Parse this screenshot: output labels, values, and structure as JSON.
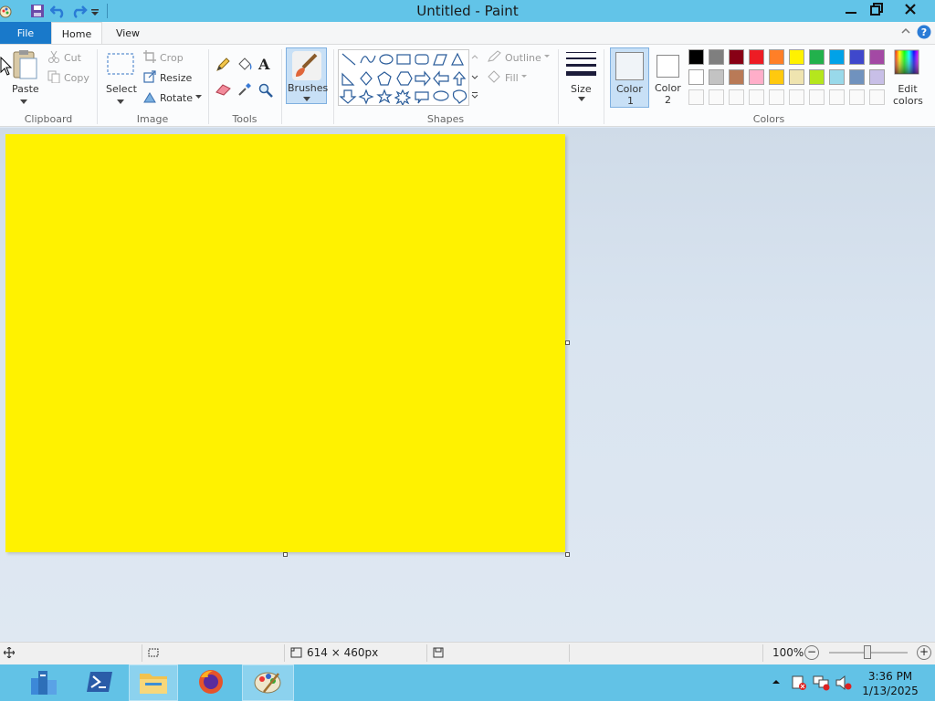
{
  "window": {
    "title": "Untitled - Paint",
    "minimize_glyph": "—",
    "close_glyph": "✕"
  },
  "ribbon": {
    "tabs": {
      "file": "File",
      "home": "Home",
      "view": "View"
    },
    "clipboard": {
      "paste": "Paste",
      "cut": "Cut",
      "copy": "Copy",
      "group": "Clipboard"
    },
    "image": {
      "select": "Select",
      "crop": "Crop",
      "resize": "Resize",
      "rotate": "Rotate",
      "group": "Image"
    },
    "tools": {
      "group": "Tools",
      "text_glyph": "A"
    },
    "brushes": {
      "label": "Brushes"
    },
    "shapes": {
      "outline": "Outline",
      "fill": "Fill",
      "group": "Shapes"
    },
    "size": {
      "label": "Size"
    },
    "color1": {
      "label": "Color",
      "number": "1",
      "value": "#f0f4f8"
    },
    "color2": {
      "label": "Color",
      "number": "2",
      "value": "#ffffff"
    },
    "colors": {
      "group": "Colors",
      "edit_line1": "Edit",
      "edit_line2": "colors"
    },
    "palette_row1": [
      "#000000",
      "#7f7f7f",
      "#880015",
      "#ed1c24",
      "#ff7f27",
      "#fff200",
      "#22b14c",
      "#00a2e8",
      "#3f48cc",
      "#a349a4"
    ],
    "palette_row2": [
      "#ffffff",
      "#c3c3c3",
      "#b97a57",
      "#ffaec9",
      "#ffc90e",
      "#efe4b0",
      "#b5e61d",
      "#99d9ea",
      "#7092be",
      "#c8bfe7"
    ]
  },
  "canvas": {
    "fill_color": "#fff200"
  },
  "status": {
    "dimensions": "614 × 460px",
    "zoom": "100%",
    "zoom_minus": "−",
    "zoom_plus": "+"
  },
  "taskbar": {
    "time": "3:36 PM",
    "date": "1/13/2025"
  },
  "icons": [
    "paint-app-icon",
    "save-icon",
    "undo-icon",
    "redo-icon",
    "customize-qat-icon",
    "minimize-icon",
    "restore-icon",
    "close-icon",
    "help-icon",
    "collapse-ribbon-icon",
    "paste-icon",
    "cut-icon",
    "copy-icon",
    "select-icon",
    "crop-icon",
    "resize-icon",
    "rotate-icon",
    "pencil-icon",
    "fill-icon",
    "text-icon",
    "eraser-icon",
    "color-picker-icon",
    "magnifier-icon",
    "brush-icon",
    "outline-icon",
    "fill-shape-icon",
    "size-icon",
    "rainbow-icon",
    "cursor-position-icon",
    "selection-size-icon",
    "canvas-size-icon",
    "disk-icon",
    "server-manager-icon",
    "powershell-icon",
    "file-explorer-icon",
    "firefox-icon",
    "paint-taskbar-icon",
    "tray-up-icon",
    "action-center-icon",
    "network-icon",
    "volume-icon"
  ]
}
